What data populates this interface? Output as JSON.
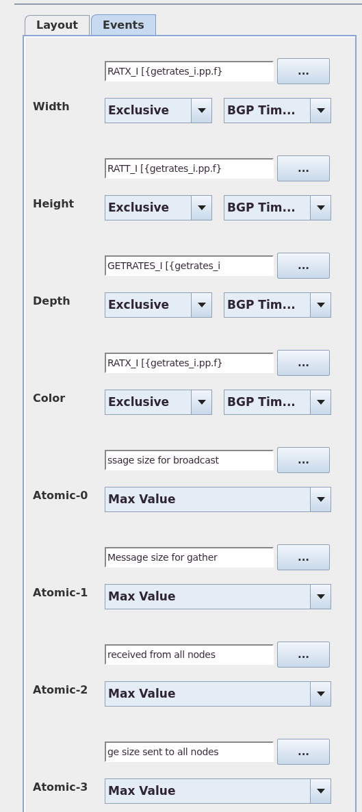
{
  "tabs": [
    {
      "label": "Layout",
      "selected": false
    },
    {
      "label": "Events",
      "selected": true
    }
  ],
  "rows": [
    {
      "label": "Width",
      "event": "RATX_I [{getrates_i.pp.f}",
      "button": "...",
      "selects": [
        "Exclusive",
        "BGP Tim..."
      ]
    },
    {
      "label": "Height",
      "event": "RATT_I [{getrates_i.pp.f}",
      "button": "...",
      "selects": [
        "Exclusive",
        "BGP Tim..."
      ]
    },
    {
      "label": "Depth",
      "event": "GETRATES_I [{getrates_i",
      "button": "...",
      "selects": [
        "Exclusive",
        "BGP Tim..."
      ]
    },
    {
      "label": "Color",
      "event": "RATX_I [{getrates_i.pp.f}",
      "button": "...",
      "selects": [
        "Exclusive",
        "BGP Tim..."
      ]
    },
    {
      "label": "Atomic-0",
      "event": "ssage size for broadcast",
      "button": "...",
      "selects": [
        "Max Value"
      ]
    },
    {
      "label": "Atomic-1",
      "event": "Message size for gather",
      "button": "...",
      "selects": [
        "Max Value"
      ]
    },
    {
      "label": "Atomic-2",
      "event": "received from all nodes",
      "button": "...",
      "selects": [
        "Max Value"
      ]
    },
    {
      "label": "Atomic-3",
      "event": "ge size sent to all nodes",
      "button": "...",
      "selects": [
        "Max Value"
      ]
    }
  ]
}
